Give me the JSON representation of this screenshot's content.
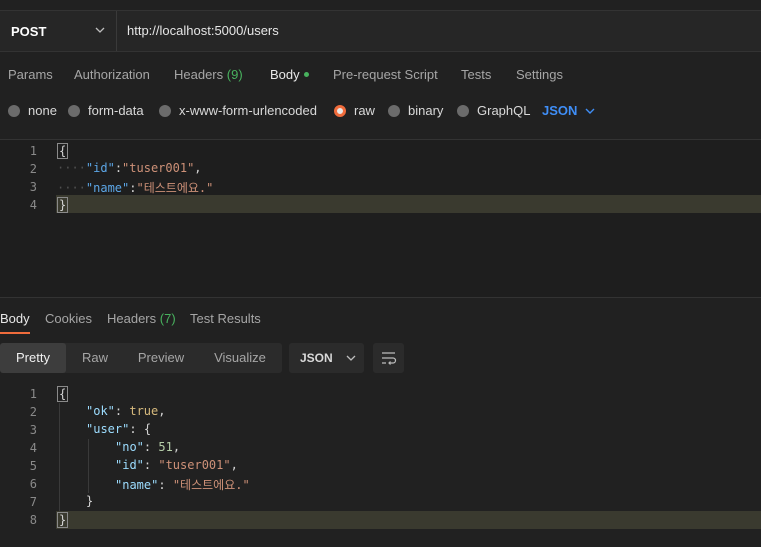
{
  "request": {
    "method": "POST",
    "url": "http://localhost:5000/users"
  },
  "tabs": {
    "params": "Params",
    "authorization": "Authorization",
    "headers": "Headers",
    "headers_count": "(9)",
    "body": "Body",
    "pre_request": "Pre-request Script",
    "tests": "Tests",
    "settings": "Settings"
  },
  "body_types": {
    "none": "none",
    "form_data": "form-data",
    "urlencoded": "x-www-form-urlencoded",
    "raw": "raw",
    "binary": "binary",
    "graphql": "GraphQL",
    "format": "JSON",
    "selected": "raw"
  },
  "request_editor": {
    "line_numbers": [
      "1",
      "2",
      "3",
      "4"
    ],
    "open_brace": "{",
    "close_brace": "}",
    "id_key": "\"id\"",
    "id_value": "\"tuser001\"",
    "name_key": "\"name\"",
    "name_value": "\"테스트에요.\""
  },
  "response_tabs": {
    "body": "Body",
    "cookies": "Cookies",
    "headers": "Headers",
    "headers_count": "(7)",
    "test_results": "Test Results"
  },
  "view": {
    "pretty": "Pretty",
    "raw": "Raw",
    "preview": "Preview",
    "visualize": "Visualize",
    "format": "JSON"
  },
  "response_editor": {
    "line_numbers": [
      "1",
      "2",
      "3",
      "4",
      "5",
      "6",
      "7",
      "8"
    ],
    "open_brace": "{",
    "close_brace": "}",
    "ok_key": "\"ok\"",
    "ok_value": "true",
    "user_key": "\"user\"",
    "inner_open": "{",
    "inner_close": "}",
    "no_key": "\"no\"",
    "no_value": "51",
    "id_key": "\"id\"",
    "id_value": "\"tuser001\"",
    "name_key": "\"name\"",
    "name_value": "\"테스트에요.\""
  },
  "colors": {
    "accent_orange": "#f06c3c",
    "accent_green": "#48b25e",
    "link_blue": "#3f8ef7"
  },
  "icons": [
    "chevron-down-icon",
    "wrap-lines-icon"
  ]
}
